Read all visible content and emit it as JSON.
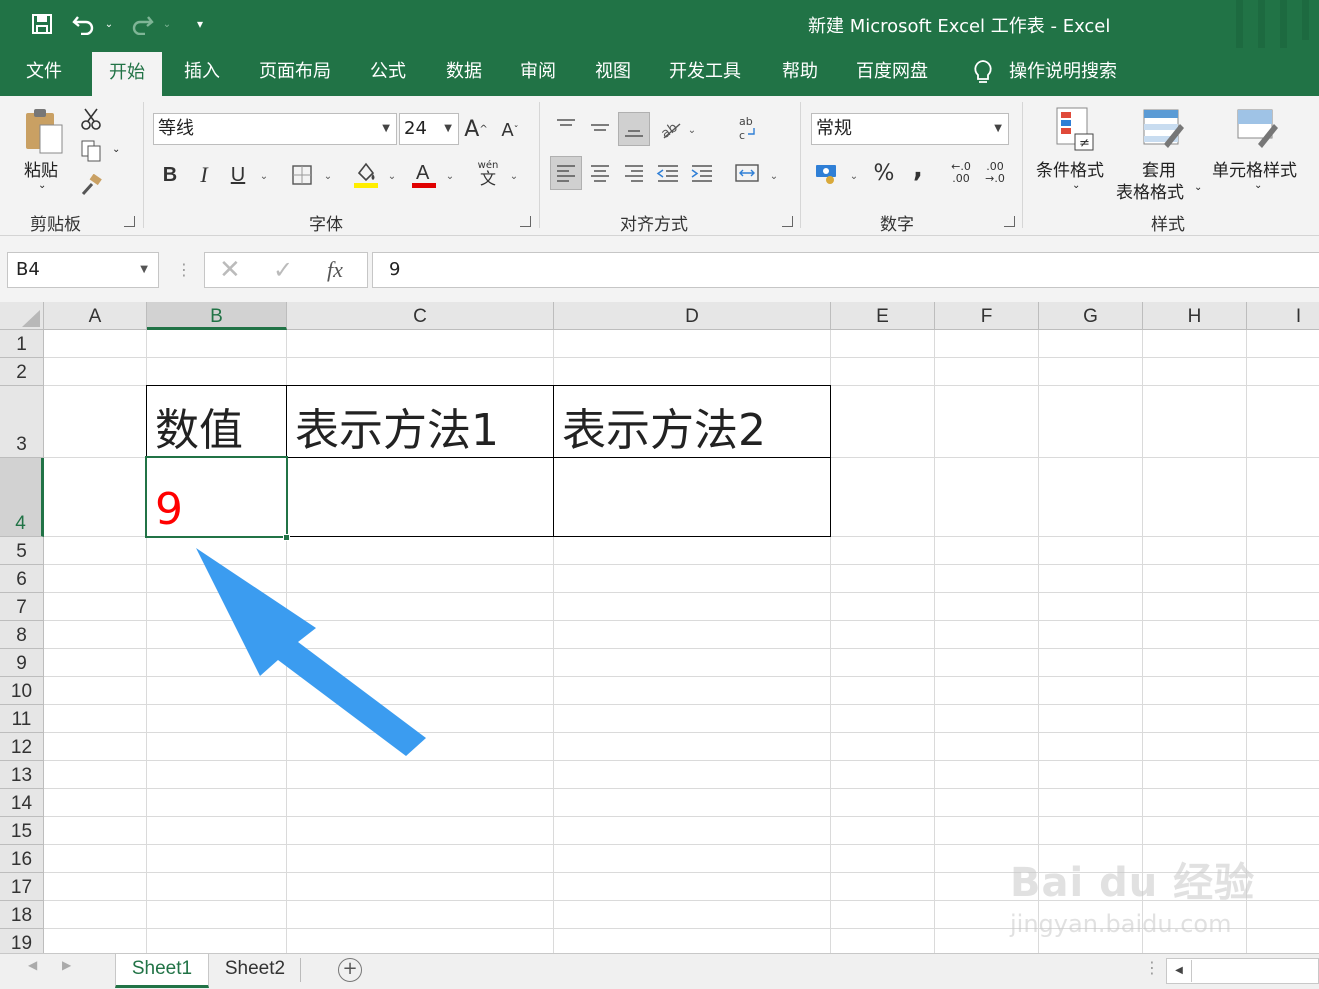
{
  "title_bar": {
    "title": "新建 Microsoft Excel 工作表  -  Excel",
    "icons": [
      "save-icon",
      "undo-icon",
      "redo-icon",
      "customize-icon"
    ]
  },
  "tabs": [
    {
      "label": "文件",
      "active": false
    },
    {
      "label": "开始",
      "active": true
    },
    {
      "label": "插入",
      "active": false
    },
    {
      "label": "页面布局",
      "active": false
    },
    {
      "label": "公式",
      "active": false
    },
    {
      "label": "数据",
      "active": false
    },
    {
      "label": "审阅",
      "active": false
    },
    {
      "label": "视图",
      "active": false
    },
    {
      "label": "开发工具",
      "active": false
    },
    {
      "label": "帮助",
      "active": false
    },
    {
      "label": "百度网盘",
      "active": false
    },
    {
      "label": "操作说明搜索",
      "active": false
    }
  ],
  "ribbon": {
    "clipboard": {
      "paste_label": "粘贴",
      "group_label": "剪贴板"
    },
    "font": {
      "font_name": "等线",
      "font_size": "24",
      "bold": "B",
      "italic": "I",
      "underline": "U",
      "group_label": "字体",
      "phonetic": "wén"
    },
    "alignment": {
      "group_label": "对齐方式"
    },
    "number": {
      "format": "常规",
      "percent": "%",
      "comma": ",",
      "group_label": "数字",
      "inc_decimal": "←.0 .00",
      "dec_decimal": ".00 →.0"
    },
    "styles": {
      "conditional": "条件格式",
      "table_line1": "套用",
      "table_line2": "表格格式",
      "cell_styles": "单元格样式",
      "group_label": "样式"
    }
  },
  "formula_bar": {
    "name_box": "B4",
    "value": "9"
  },
  "columns": [
    "A",
    "B",
    "C",
    "D",
    "E",
    "F",
    "G",
    "H",
    "I"
  ],
  "rows": [
    "1",
    "2",
    "3",
    "4",
    "5",
    "6",
    "7",
    "8",
    "9",
    "10",
    "11",
    "12",
    "13",
    "14",
    "15",
    "16",
    "17",
    "18",
    "19"
  ],
  "selected_cell": "B4",
  "cells": {
    "B3": "数值",
    "C3": "表示方法1",
    "D3": "表示方法2",
    "B4": "9"
  },
  "colors": {
    "accent": "#217346",
    "cell_B4_text": "#ff0000",
    "arrow": "#3b9cf0"
  },
  "sheets": [
    {
      "name": "Sheet1",
      "active": true
    },
    {
      "name": "Sheet2",
      "active": false
    }
  ],
  "watermark": {
    "brand": "Bai  du 经验",
    "url": "jingyan.baidu.com"
  }
}
